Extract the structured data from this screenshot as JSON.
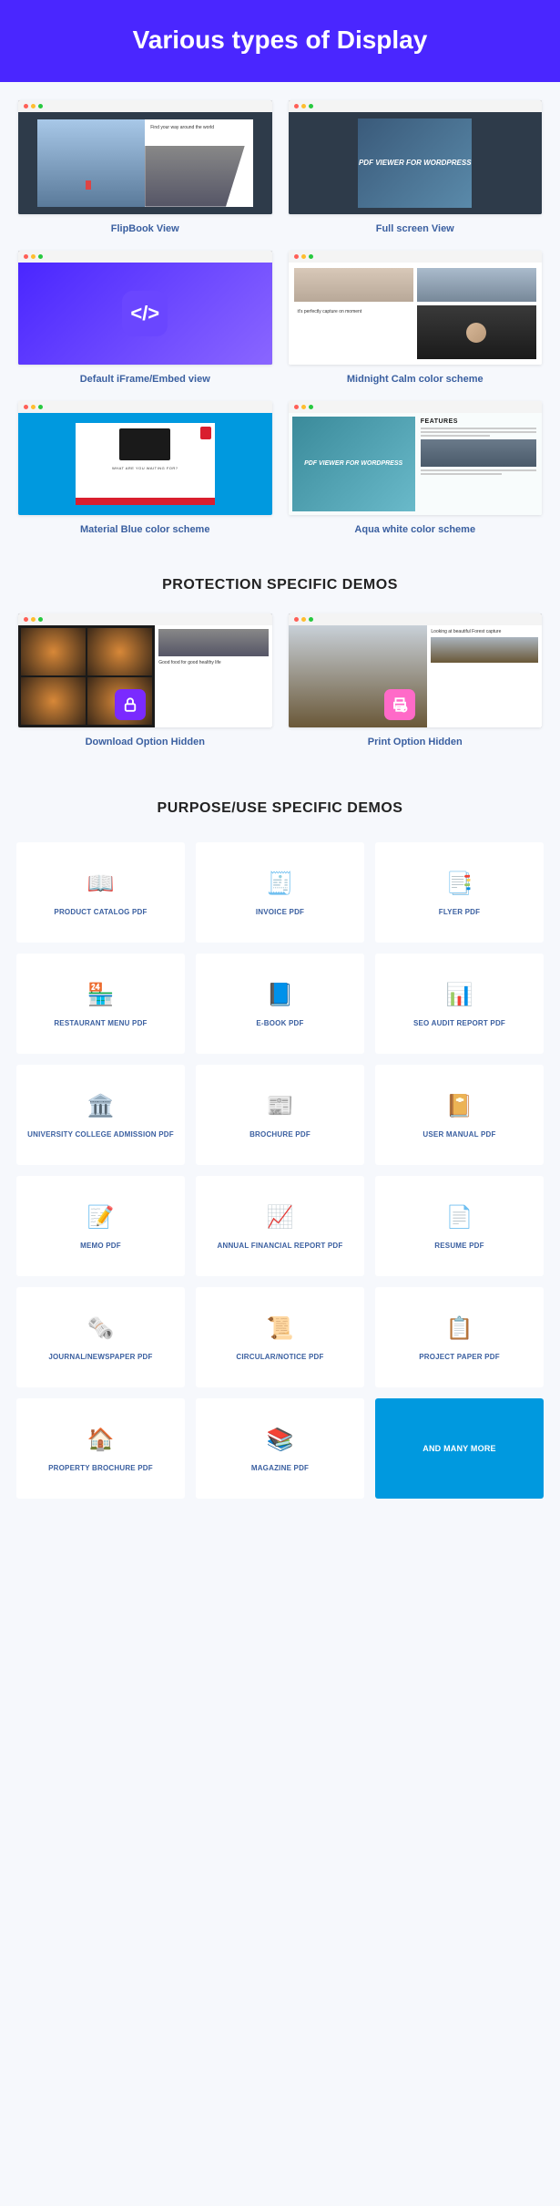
{
  "hero": {
    "title": "Various types of Display"
  },
  "displays": [
    {
      "label": "FlipBook View"
    },
    {
      "label": "Full screen View"
    },
    {
      "label": "Default iFrame/Embed view"
    },
    {
      "label": "Midnight Calm color scheme"
    },
    {
      "label": "Material Blue color scheme"
    },
    {
      "label": "Aqua white color scheme"
    }
  ],
  "display_content": {
    "book_right_title": "Find your way around the world",
    "pdf_cover_text": "PDF VIEWER FOR WORDPRESS",
    "midnight_text": "it's perfectly capture on moment",
    "macbook_text": "WHAT ARE YOU WAITING FOR?",
    "aqua_left_text": "PDF VIEWER FOR WORDPRESS",
    "aqua_features": "FEATURES"
  },
  "sections": {
    "protection_title": "PROTECTION SPECIFIC DEMOS",
    "purpose_title": "PURPOSE/USE SPECIFIC DEMOS"
  },
  "protection": [
    {
      "label": "Download Option Hidden"
    },
    {
      "label": "Print Option Hidden"
    }
  ],
  "protection_content": {
    "food_text": "Good food for good healthy life",
    "forest_title": "Looking at beautiful Forest capture"
  },
  "purpose": [
    {
      "label": "PRODUCT CATALOG PDF",
      "icon": "📖"
    },
    {
      "label": "INVOICE PDF",
      "icon": "🧾"
    },
    {
      "label": "FLYER PDF",
      "icon": "📑"
    },
    {
      "label": "RESTAURANT MENU PDF",
      "icon": "🏪"
    },
    {
      "label": "E-BOOK PDF",
      "icon": "📘"
    },
    {
      "label": "SEO AUDIT REPORT PDF",
      "icon": "📊"
    },
    {
      "label": "UNIVERSITY COLLEGE ADMISSION PDF",
      "icon": "🏛️"
    },
    {
      "label": "BROCHURE PDF",
      "icon": "📰"
    },
    {
      "label": "USER MANUAL PDF",
      "icon": "📔"
    },
    {
      "label": "MEMO PDF",
      "icon": "📝"
    },
    {
      "label": "ANNUAL FINANCIAL REPORT PDF",
      "icon": "📈"
    },
    {
      "label": "RESUME PDF",
      "icon": "📄"
    },
    {
      "label": "JOURNAL/NEWSPAPER PDF",
      "icon": "🗞️"
    },
    {
      "label": "CIRCULAR/NOTICE PDF",
      "icon": "📜"
    },
    {
      "label": "PROJECT PAPER PDF",
      "icon": "📋"
    },
    {
      "label": "PROPERTY BROCHURE PDF",
      "icon": "🏠"
    },
    {
      "label": "MAGAZINE PDF",
      "icon": "📚"
    },
    {
      "label": "AND MANY MORE",
      "cta": true
    }
  ]
}
